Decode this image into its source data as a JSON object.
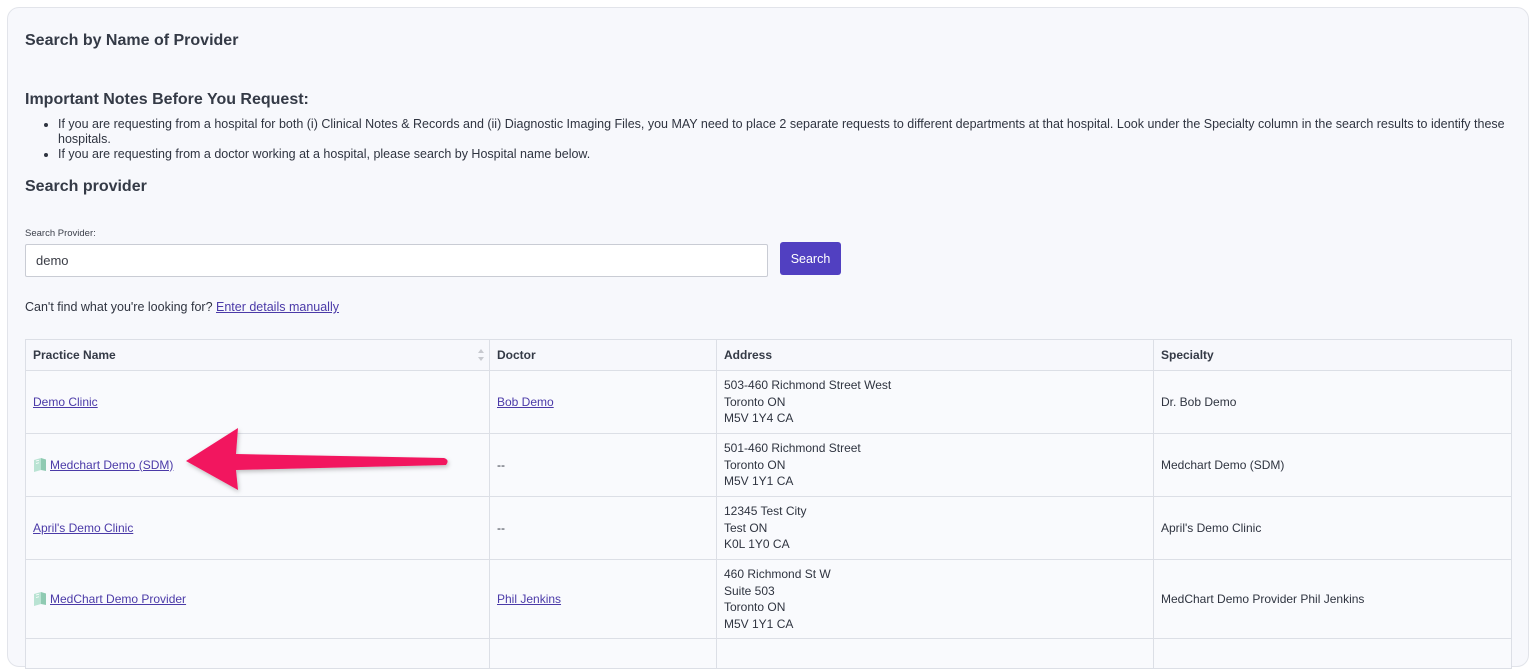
{
  "page": {
    "title": "Search by Name of Provider",
    "notes_title": "Important Notes Before You Request:",
    "notes": [
      "If you are requesting from a hospital for both (i) Clinical Notes & Records and (ii) Diagnostic Imaging Files, you MAY need to place 2 separate requests to different departments at that hospital. Look under the Specialty column in the search results to identify these hospitals.",
      "If you are requesting from a doctor working at a hospital, please search by Hospital name below."
    ],
    "section_title": "Search provider"
  },
  "search": {
    "label": "Search Provider:",
    "value": "demo",
    "button_label": "Search"
  },
  "help": {
    "text": "Can't find what you're looking for? ",
    "link_label": "Enter details manually"
  },
  "table": {
    "columns": [
      "Practice Name",
      "Doctor",
      "Address",
      "Specialty"
    ],
    "rows": [
      {
        "practice": "Demo Clinic",
        "verified": false,
        "doctor": "Bob Demo",
        "doctor_link": true,
        "address": [
          "503-460 Richmond Street West",
          "Toronto ON",
          "M5V 1Y4 CA"
        ],
        "specialty": "Dr. Bob Demo"
      },
      {
        "practice": "Medchart Demo (SDM)",
        "verified": true,
        "doctor": "--",
        "doctor_link": false,
        "address": [
          "501-460 Richmond Street",
          "Toronto ON",
          "M5V 1Y1 CA"
        ],
        "specialty": "Medchart Demo (SDM)"
      },
      {
        "practice": "April's Demo Clinic",
        "verified": false,
        "doctor": "--",
        "doctor_link": false,
        "address": [
          "12345 Test City",
          "Test ON",
          "K0L 1Y0 CA"
        ],
        "specialty": "April's Demo Clinic"
      },
      {
        "practice": "MedChart Demo Provider",
        "verified": true,
        "doctor": "Phil Jenkins",
        "doctor_link": true,
        "address": [
          "460 Richmond St W",
          "Suite 503",
          "Toronto ON",
          "M5V 1Y1 CA"
        ],
        "specialty": "MedChart Demo Provider Phil Jenkins"
      }
    ]
  },
  "colors": {
    "accent": "#5140c1",
    "link": "#4b3aa8",
    "annotation_arrow": "#f2155e",
    "verified_icon": "#9fd3bf"
  },
  "icons": {
    "verified": "book-icon",
    "sort": "sort-arrows-icon",
    "annotation": "arrow-annotation-icon"
  }
}
